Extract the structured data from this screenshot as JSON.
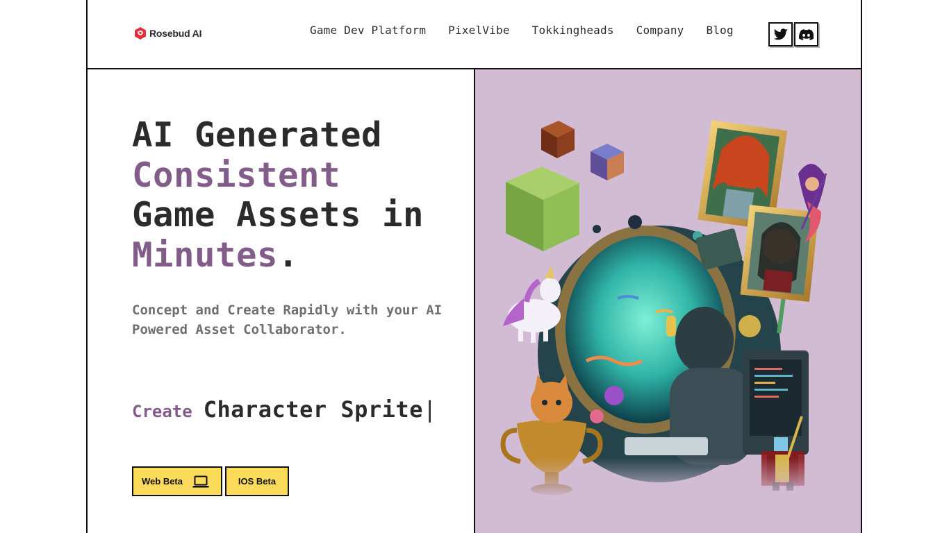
{
  "brand": {
    "name": "Rosebud AI",
    "color": "#e0323e"
  },
  "nav": {
    "items": [
      {
        "label": "Game Dev Platform"
      },
      {
        "label": "PixelVibe"
      },
      {
        "label": "Tokkingheads"
      },
      {
        "label": "Company"
      },
      {
        "label": "Blog"
      }
    ],
    "social": [
      {
        "icon": "twitter-icon"
      },
      {
        "icon": "discord-icon"
      }
    ]
  },
  "hero": {
    "headline": {
      "line1": "AI Generated",
      "accent1": "Consistent",
      "line3": "Game Assets in",
      "accent2": "Minutes",
      "period": "."
    },
    "subheadline": "Concept and Create Rapidly with your AI Powered Asset Collaborator.",
    "create_label": "Create",
    "create_value": "Character Sprite",
    "cursor": "|",
    "buttons": {
      "web": "Web Beta",
      "ios": "IOS Beta"
    }
  },
  "colors": {
    "accent": "#835d8a",
    "button_bg": "#fddb5a",
    "panel_bg": "#d2bcd4"
  }
}
